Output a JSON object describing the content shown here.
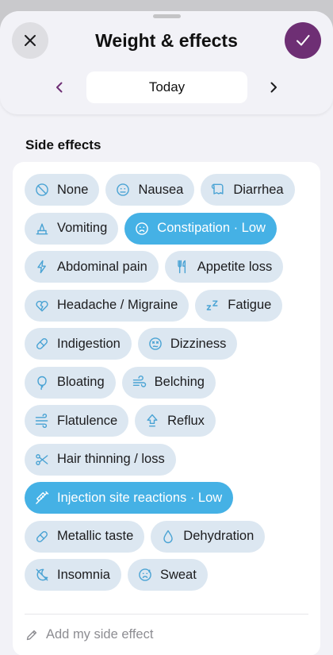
{
  "header": {
    "title": "Weight & effects",
    "date_label": "Today"
  },
  "colors": {
    "accent": "#6e2f74",
    "chip_bg": "#dce7f1",
    "chip_selected": "#45b1e5",
    "icon": "#4aa3d4"
  },
  "section": {
    "title": "Side effects"
  },
  "chips": [
    {
      "label": "None",
      "icon": "none-icon",
      "selected": false
    },
    {
      "label": "Nausea",
      "icon": "nausea-face-icon",
      "selected": false
    },
    {
      "label": "Diarrhea",
      "icon": "toilet-paper-icon",
      "selected": false
    },
    {
      "label": "Vomiting",
      "icon": "vomiting-icon",
      "selected": false
    },
    {
      "label": "Constipation · Low",
      "icon": "constipation-face-icon",
      "selected": true
    },
    {
      "label": "Abdominal pain",
      "icon": "lightning-icon",
      "selected": false
    },
    {
      "label": "Appetite loss",
      "icon": "fork-knife-icon",
      "selected": false
    },
    {
      "label": "Headache / Migraine",
      "icon": "broken-heart-icon",
      "selected": false
    },
    {
      "label": "Fatigue",
      "icon": "sleep-zz-icon",
      "selected": false
    },
    {
      "label": "Indigestion",
      "icon": "pill-icon",
      "selected": false
    },
    {
      "label": "Dizziness",
      "icon": "dizzy-face-icon",
      "selected": false
    },
    {
      "label": "Bloating",
      "icon": "balloon-icon",
      "selected": false
    },
    {
      "label": "Belching",
      "icon": "wind-icon",
      "selected": false
    },
    {
      "label": "Flatulence",
      "icon": "gas-icon",
      "selected": false
    },
    {
      "label": "Reflux",
      "icon": "reflux-arrow-icon",
      "selected": false
    },
    {
      "label": "Hair thinning / loss",
      "icon": "scissors-icon",
      "selected": false
    },
    {
      "label": "Injection site reactions · Low",
      "icon": "syringe-icon",
      "selected": true
    },
    {
      "label": "Metallic taste",
      "icon": "capsule-icon",
      "selected": false
    },
    {
      "label": "Dehydration",
      "icon": "droplet-icon",
      "selected": false
    },
    {
      "label": "Insomnia",
      "icon": "moon-slash-icon",
      "selected": false
    },
    {
      "label": "Sweat",
      "icon": "sweat-face-icon",
      "selected": false
    }
  ],
  "add": {
    "label": "Add my side effect",
    "icon": "pencil-icon"
  }
}
